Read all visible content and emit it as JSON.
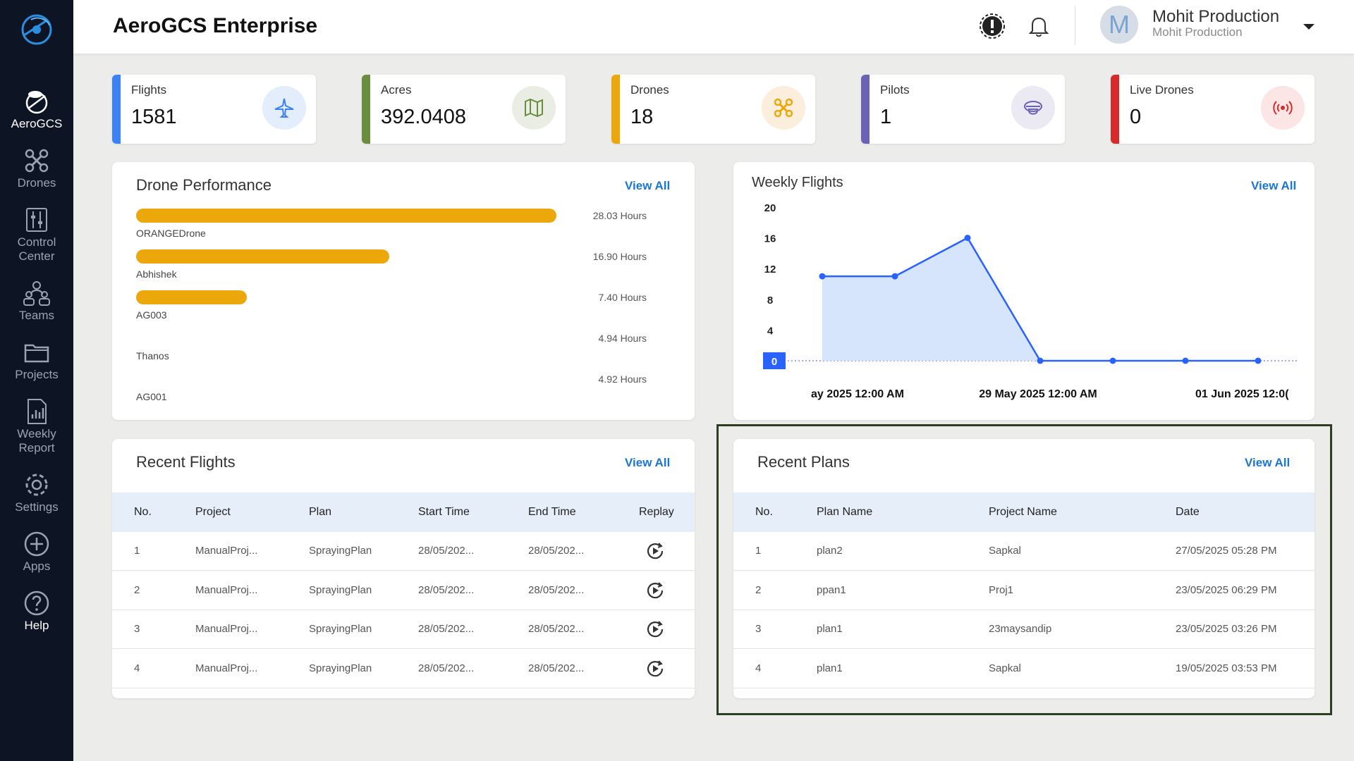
{
  "app": {
    "title": "AeroGCS Enterprise"
  },
  "sidebar": {
    "items": [
      {
        "label": "AeroGCS",
        "icon": "aerogcs-icon"
      },
      {
        "label": "Drones",
        "icon": "drone-icon"
      },
      {
        "label": "Control Center",
        "icon": "control-center-icon"
      },
      {
        "label": "Teams",
        "icon": "teams-icon"
      },
      {
        "label": "Projects",
        "icon": "folder-icon"
      },
      {
        "label": "Weekly Report",
        "icon": "report-icon"
      },
      {
        "label": "Settings",
        "icon": "gear-icon"
      },
      {
        "label": "Apps",
        "icon": "plus-circle-icon"
      },
      {
        "label": "Help",
        "icon": "help-icon"
      }
    ]
  },
  "user": {
    "initial": "M",
    "name": "Mohit Production",
    "subtitle": "Mohit Production"
  },
  "stats": [
    {
      "label": "Flights",
      "value": "1581",
      "color": "#3b82f6",
      "icon": "airplane-icon"
    },
    {
      "label": "Acres",
      "value": "392.0408",
      "color": "#6b8e3e",
      "icon": "map-icon"
    },
    {
      "label": "Drones",
      "value": "18",
      "color": "#eca80a",
      "icon": "drone-icon"
    },
    {
      "label": "Pilots",
      "value": "1",
      "color": "#6b62b5",
      "icon": "pilot-icon"
    },
    {
      "label": "Live Drones",
      "value": "0",
      "color": "#d62b2b",
      "icon": "broadcast-icon"
    }
  ],
  "drone_performance": {
    "title": "Drone Performance",
    "view_all": "View All",
    "rows": [
      {
        "name": "ORANGEDrone",
        "hours": "28.03 Hours",
        "value": 28.03
      },
      {
        "name": "Abhishek",
        "hours": "16.90 Hours",
        "value": 16.9
      },
      {
        "name": "AG003",
        "hours": "7.40 Hours",
        "value": 7.4
      },
      {
        "name": "Thanos",
        "hours": "4.94 Hours",
        "value": 4.94
      },
      {
        "name": "AG001",
        "hours": "4.92 Hours",
        "value": 4.92
      }
    ]
  },
  "weekly_flights": {
    "title": "Weekly Flights",
    "view_all": "View All",
    "x_labels_shown": [
      "ay 2025 12:00 AM",
      "29 May 2025 12:00 AM",
      "01 Jun 2025 12:0("
    ]
  },
  "chart_data": {
    "type": "area",
    "yticks": [
      0,
      4,
      8,
      12,
      16,
      20
    ],
    "ylim": [
      0,
      20
    ],
    "values": [
      11,
      11,
      16,
      0,
      0,
      0,
      0
    ],
    "x_tick_labels": [
      "ay 2025 12:00 AM",
      "29 May 2025 12:00 AM",
      "01 Jun 2025 12:0("
    ],
    "line_color": "#2962ff",
    "fill_color": "#cfe0fb"
  },
  "recent_flights": {
    "title": "Recent Flights",
    "view_all": "View All",
    "columns": [
      "No.",
      "Project",
      "Plan",
      "Start Time",
      "End Time",
      "Replay"
    ],
    "rows": [
      [
        "1",
        "ManualProj...",
        "SprayingPlan",
        "28/05/202...",
        "28/05/202..."
      ],
      [
        "2",
        "ManualProj...",
        "SprayingPlan",
        "28/05/202...",
        "28/05/202..."
      ],
      [
        "3",
        "ManualProj...",
        "SprayingPlan",
        "28/05/202...",
        "28/05/202..."
      ],
      [
        "4",
        "ManualProj...",
        "SprayingPlan",
        "28/05/202...",
        "28/05/202..."
      ]
    ]
  },
  "recent_plans": {
    "title": "Recent Plans",
    "view_all": "View All",
    "columns": [
      "No.",
      "Plan Name",
      "Project Name",
      "Date"
    ],
    "rows": [
      [
        "1",
        "plan2",
        "Sapkal",
        "27/05/2025 05:28 PM"
      ],
      [
        "2",
        "ppan1",
        "Proj1",
        "23/05/2025 06:29 PM"
      ],
      [
        "3",
        "plan1",
        "23maysandip",
        "23/05/2025 03:26 PM"
      ],
      [
        "4",
        "plan1",
        "Sapkal",
        "19/05/2025 03:53 PM"
      ]
    ]
  }
}
